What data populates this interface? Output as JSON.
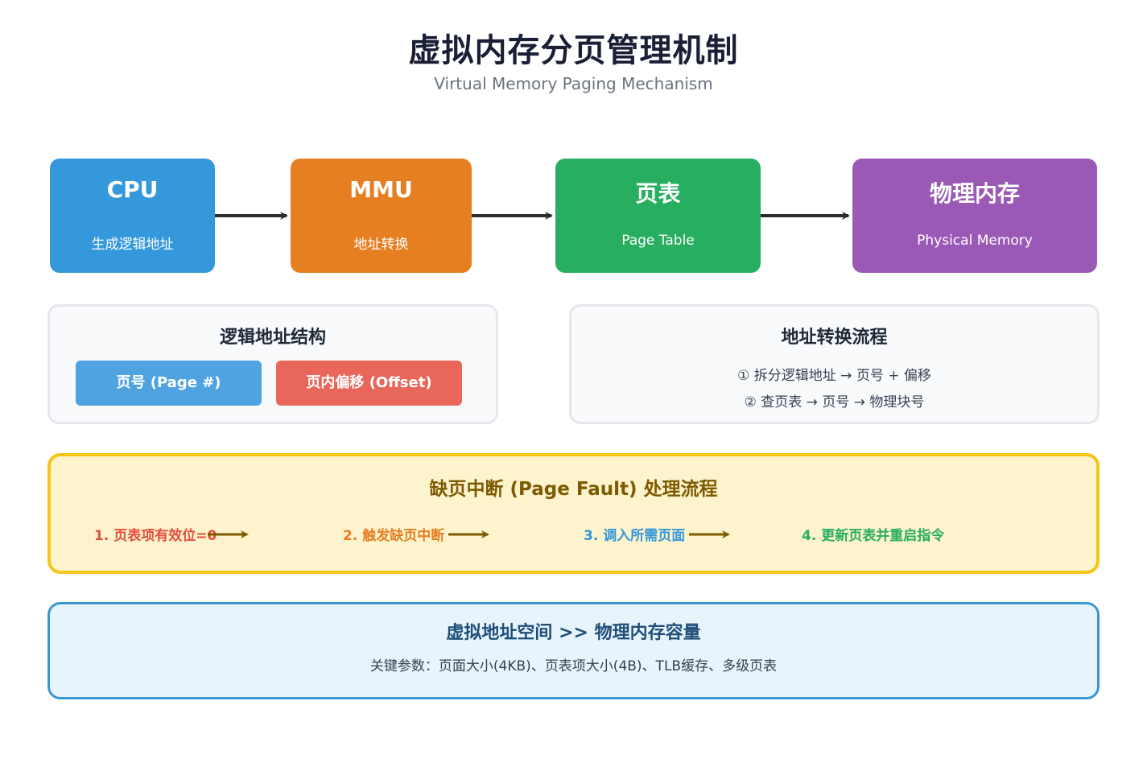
{
  "title": "虚拟内存分页管理机制",
  "subtitle": "Virtual Memory Paging Mechanism",
  "nodes": [
    {
      "title": "CPU",
      "subtitle": "生成逻辑地址",
      "color": "#3498db"
    },
    {
      "title": "MMU",
      "subtitle": "地址转换",
      "color": "#e67e22"
    },
    {
      "title": "页表",
      "subtitle": "Page Table",
      "color": "#27ae60"
    },
    {
      "title": "物理内存",
      "subtitle": "Physical Memory",
      "color": "#9b59b6"
    }
  ],
  "logical_address": {
    "title": "逻辑地址结构",
    "page_number": "页号 (Page #)",
    "offset": "页内偏移 (Offset)",
    "page_color": "#4fa3e0",
    "offset_color": "#e8665a"
  },
  "translation": {
    "title": "地址转换流程",
    "step1": "① 拆分逻辑地址 → 页号 + 偏移",
    "step2": "② 查页表 → 页号 → 物理块号"
  },
  "page_fault": {
    "title": "缺页中断 (Page Fault) 处理流程",
    "steps": [
      {
        "label": "1. 页表项有效位=0",
        "color": "#e74c3c"
      },
      {
        "label": "2. 触发缺页中断",
        "color": "#e67e22"
      },
      {
        "label": "3. 调入所需页面",
        "color": "#3498db"
      },
      {
        "label": "4. 更新页表并重启指令",
        "color": "#27ae60"
      }
    ],
    "arrow_color": "#7d5a00",
    "title_color": "#7d5a00"
  },
  "summary": {
    "title": "虚拟地址空间 >> 物理内存容量",
    "params": "关键参数：页面大小(4KB)、页表项大小(4B)、TLB缓存、多级页表",
    "title_color": "#1f4e79"
  }
}
